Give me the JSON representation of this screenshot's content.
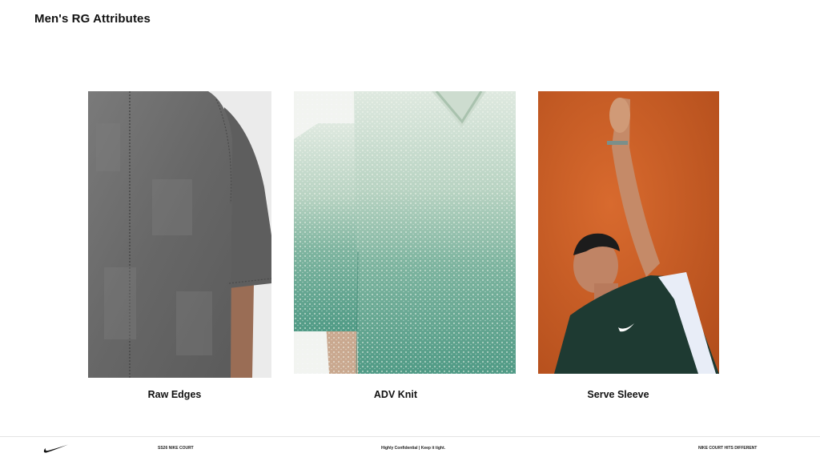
{
  "slide": {
    "title": "Men's RG Attributes"
  },
  "cards": [
    {
      "caption": "Raw Edges"
    },
    {
      "caption": "ADV Knit"
    },
    {
      "caption": "Serve Sleeve"
    }
  ],
  "footer": {
    "left": "SS26 NIKE COURT",
    "center": "Highly Confidential | Keep it tight.",
    "right": "NIKE COURT HITS DIFFERENT",
    "logo_icon": "nike-swoosh-icon"
  },
  "colors": {
    "clay": "#c95a22",
    "shirt_grey": "#6f6f6f",
    "knit_green": "#4f9a85"
  }
}
